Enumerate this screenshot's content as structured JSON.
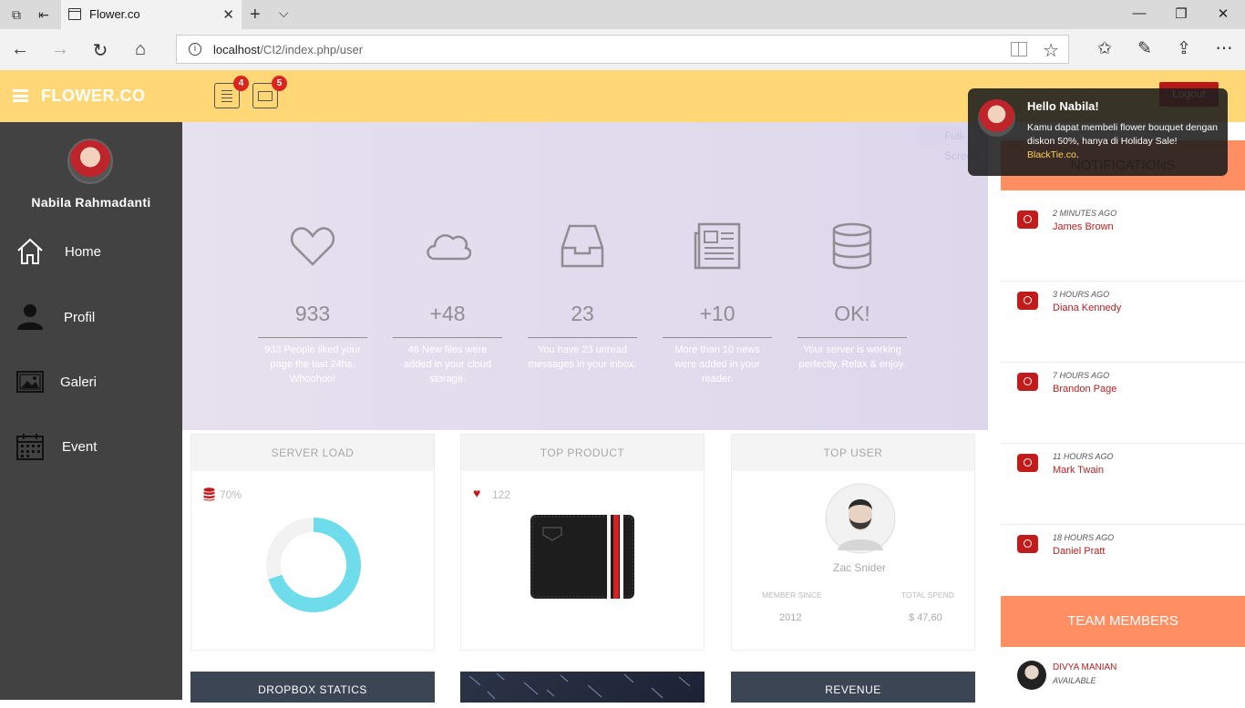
{
  "browser": {
    "tab_title": "Flower.co",
    "url_host": "localhost",
    "url_path": "/CI2/index.php/user"
  },
  "header": {
    "logo": "FLOWER.CO",
    "tasks_badge": "4",
    "mail_badge": "5",
    "logout": "Logout"
  },
  "sidebar": {
    "user_name": "Nabila Rahmadanti",
    "items": [
      {
        "label": "Home",
        "icon": "home-icon"
      },
      {
        "label": "Profil",
        "icon": "user-icon"
      },
      {
        "label": "Galeri",
        "icon": "image-icon"
      },
      {
        "label": "Event",
        "icon": "calendar-icon"
      }
    ]
  },
  "hero": {
    "fullscreen_label": "Full-Screen",
    "stats": [
      {
        "icon": "heart-icon",
        "value": "933",
        "desc": "933 People liked your page the last 24hs. Whoohoo!"
      },
      {
        "icon": "cloud-icon",
        "value": "+48",
        "desc": "48 New files were added in your cloud storage."
      },
      {
        "icon": "inbox-icon",
        "value": "23",
        "desc": "You have 23 unread messages in your inbox."
      },
      {
        "icon": "newspaper-icon",
        "value": "+10",
        "desc": "More than 10 news were added in your reader."
      },
      {
        "icon": "database-icon",
        "value": "OK!",
        "desc": "Your server is working perfectly. Relax & enjoy."
      }
    ]
  },
  "cards": {
    "server_load": {
      "title": "SERVER LOAD",
      "percent_label": "70%",
      "percent": 70
    },
    "top_product": {
      "title": "TOP PRODUCT",
      "likes": "122"
    },
    "top_user": {
      "title": "TOP USER",
      "name": "Zac Snider",
      "member_since_label": "MEMBER SINCE",
      "member_since": "2012",
      "total_spend_label": "TOTAL SPEND",
      "total_spend": "$ 47,60"
    },
    "dropbox": {
      "title": "DROPBOX STATICS"
    },
    "revenue": {
      "title": "REVENUE"
    }
  },
  "notifications": {
    "title": "NOTIFICATIONS",
    "items": [
      {
        "time": "2 MINUTES AGO",
        "name": "James Brown"
      },
      {
        "time": "3 HOURS AGO",
        "name": "Diana Kennedy"
      },
      {
        "time": "7 HOURS AGO",
        "name": "Brandon Page"
      },
      {
        "time": "11 HOURS AGO",
        "name": "Mark Twain"
      },
      {
        "time": "18 HOURS AGO",
        "name": "Daniel Pratt"
      }
    ]
  },
  "team": {
    "title": "TEAM MEMBERS",
    "members": [
      {
        "name": "DIVYA MANIAN",
        "status": "AVAILABLE"
      }
    ]
  },
  "toast": {
    "title": "Hello Nabila!",
    "body": "Kamu dapat membeli flower bouquet dengan diskon 50%, hanya di Holiday Sale!",
    "link": "BlackTie.co"
  },
  "colors": {
    "header": "#ffd777",
    "sidebar": "#424242",
    "accent_orange": "#ff8f62",
    "accent_red": "#c11b1b",
    "donut": "#6fdcec"
  }
}
